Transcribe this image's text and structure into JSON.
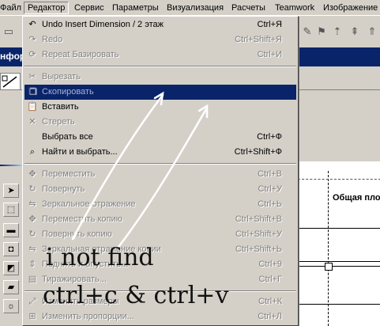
{
  "menubar": {
    "items": [
      {
        "label": "Файл",
        "active": false
      },
      {
        "label": "Редактор",
        "active": true
      },
      {
        "label": "Сервис",
        "active": false
      },
      {
        "label": "Параметры",
        "active": false
      },
      {
        "label": "Визуализация",
        "active": false
      },
      {
        "label": "Расчеты",
        "active": false
      },
      {
        "label": "Teamwork",
        "active": false
      },
      {
        "label": "Изображение",
        "active": false
      }
    ]
  },
  "background": {
    "panel_title": "нфор",
    "canvas_label": "Общая пло"
  },
  "menu": {
    "items": [
      {
        "label": "Undo Insert Dimension / 2 этаж",
        "shortcut": "Ctrl+Я",
        "disabled": false,
        "icon": "undo-icon"
      },
      {
        "label": "Redo",
        "shortcut": "Ctrl+Shift+Я",
        "disabled": true,
        "icon": "redo-icon"
      },
      {
        "label": "Repeat Базировать",
        "shortcut": "Ctrl+И",
        "disabled": true,
        "icon": "repeat-icon"
      },
      {
        "label": "Вырезать",
        "shortcut": "",
        "disabled": true,
        "icon": "scissors-icon"
      },
      {
        "label": "Скопировать",
        "shortcut": "",
        "disabled": true,
        "icon": "copy-icon",
        "highlighted": true
      },
      {
        "label": "Вставить",
        "shortcut": "",
        "disabled": false,
        "icon": "paste-icon"
      },
      {
        "label": "Стереть",
        "shortcut": "",
        "disabled": true,
        "icon": "erase-icon"
      },
      {
        "label": "Выбрать все",
        "shortcut": "Ctrl+Ф",
        "disabled": false,
        "icon": ""
      },
      {
        "label": "Найти и выбрать...",
        "shortcut": "Ctrl+Shift+Ф",
        "disabled": false,
        "icon": "find-icon"
      },
      {
        "label": "Переместить",
        "shortcut": "Ctrl+В",
        "disabled": true,
        "icon": "move-icon"
      },
      {
        "label": "Повернуть",
        "shortcut": "Ctrl+У",
        "disabled": true,
        "icon": "rotate-icon"
      },
      {
        "label": "Зеркальное отражение",
        "shortcut": "Ctrl+Ь",
        "disabled": true,
        "icon": "mirror-icon"
      },
      {
        "label": "Переместить копию",
        "shortcut": "Ctrl+Shift+В",
        "disabled": true,
        "icon": "move-copy-icon"
      },
      {
        "label": "Повернуть копию",
        "shortcut": "Ctrl+Shift+У",
        "disabled": true,
        "icon": "rotate-copy-icon"
      },
      {
        "label": "Зеркальная отражение копии",
        "shortcut": "Ctrl+Shift+Ь",
        "disabled": true,
        "icon": "mirror-copy-icon"
      },
      {
        "label": "Поднять и опустить...",
        "shortcut": "Ctrl+9",
        "disabled": true,
        "icon": "elevate-icon"
      },
      {
        "label": "Тиражировать...",
        "shortcut": "Ctrl+Г",
        "disabled": true,
        "icon": "multiply-icon"
      },
      {
        "label": "Изменить размеры",
        "shortcut": "Ctrl+К",
        "disabled": true,
        "icon": "resize-icon"
      },
      {
        "label": "Изменить пропорции...",
        "shortcut": "Ctrl+Л",
        "disabled": true,
        "icon": "proportion-icon"
      }
    ]
  },
  "annotation": {
    "line1": "i not find",
    "line2": "ctrl+c & ctrl+v"
  }
}
